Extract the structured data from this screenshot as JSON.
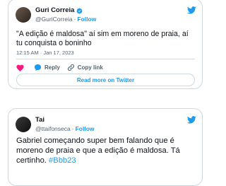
{
  "tweets": [
    {
      "display_name": "Guri Correia",
      "handle": "@GuriCorreia",
      "follow_label": "Follow",
      "text": "\"A edição é maldosa\" aí sim em moreno de praia, aí tu conquista o boninho",
      "timestamp": "12:15 AM · Jan 17, 2023",
      "reply_label": "Reply",
      "copy_link_label": "Copy link",
      "read_more_label": "Read more on Twitter",
      "verified": true
    },
    {
      "display_name": "Tai",
      "handle": "@ttaifonseca",
      "follow_label": "Follow",
      "text": "Gabriel começando super bem falando que é moreno de praia e que a edição é maldosa. Tá certinho. ",
      "hashtag": "#Bbb23"
    }
  ],
  "colors": {
    "twitter_blue": "#1d9bf0",
    "like_pink": "#f91880",
    "muted_text": "#536471",
    "border": "#cfd9de"
  },
  "icons": [
    "twitter-bird-icon",
    "verified-badge-icon",
    "heart-icon",
    "reply-icon",
    "link-icon"
  ]
}
